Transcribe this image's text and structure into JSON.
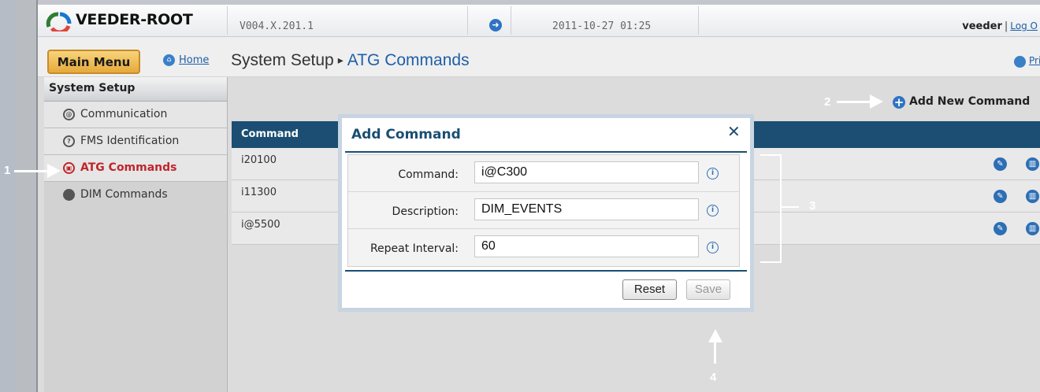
{
  "header": {
    "logo_text": "VEEDER-ROOT",
    "version": "V004.X.201.1",
    "datetime": "2011-10-27 01:25",
    "user": "veeder",
    "separator": "|",
    "logout_label": "Log O"
  },
  "subbar": {
    "main_menu_label": "Main Menu",
    "home_label": "Home",
    "breadcrumb_parent": "System Setup",
    "breadcrumb_separator": "▸",
    "breadcrumb_current": "ATG Commands",
    "print_label": "Pri"
  },
  "sidebar": {
    "heading": "System Setup",
    "items": [
      {
        "label": "Communication",
        "icon": "communication-icon"
      },
      {
        "label": "FMS Identification",
        "icon": "fms-identification-icon"
      },
      {
        "label": "ATG Commands",
        "icon": "atg-commands-icon",
        "active": true
      },
      {
        "label": "DIM Commands",
        "icon": "dim-commands-icon"
      }
    ]
  },
  "content": {
    "add_new_label": "Add New Command",
    "table": {
      "column_header": "Command",
      "rows": [
        "i20100",
        "i11300",
        "i@5500"
      ]
    }
  },
  "modal": {
    "title": "Add Command",
    "close_glyph": "✕",
    "fields": [
      {
        "label": "Command:",
        "value": "i@C300"
      },
      {
        "label": "Description:",
        "value": "DIM_EVENTS"
      },
      {
        "label": "Repeat Interval:",
        "value": "60"
      }
    ],
    "reset_label": "Reset",
    "save_label": "Save"
  },
  "annotations": {
    "callout_1": "1",
    "callout_2": "2",
    "callout_3": "3",
    "callout_4": "4"
  },
  "colors": {
    "header_blue": "#1b4e72",
    "accent_red": "#c0262b",
    "main_menu_orange": "#e7a93a",
    "link_blue": "#1f5fa8"
  }
}
